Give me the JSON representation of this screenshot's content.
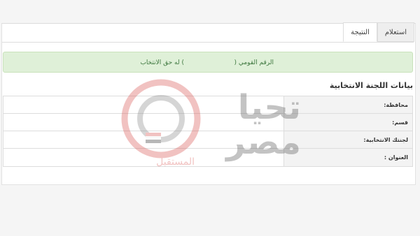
{
  "tabs": [
    {
      "label": "استعلام",
      "active": false
    },
    {
      "label": "النتيجة",
      "active": true
    }
  ],
  "result": {
    "message_prefix": "الرقم القومي (",
    "message_suffix": ") له حق الانتخاب"
  },
  "committee": {
    "title": "بيانات اللجنة الانتخابية",
    "rows": [
      {
        "label": "محافظة:",
        "value": ""
      },
      {
        "label": "قسم:",
        "value": ""
      },
      {
        "label": "لجنتك الانتخابية:",
        "value": ""
      },
      {
        "label": "العنوان :",
        "value": ""
      }
    ]
  },
  "watermark": {
    "line1": "تحيا",
    "line2": "مصر",
    "line3": "المستقبل"
  },
  "colors": {
    "alert_bg": "#dff0d8",
    "alert_text": "#3c763d",
    "watermark_red": "#d9534f"
  }
}
